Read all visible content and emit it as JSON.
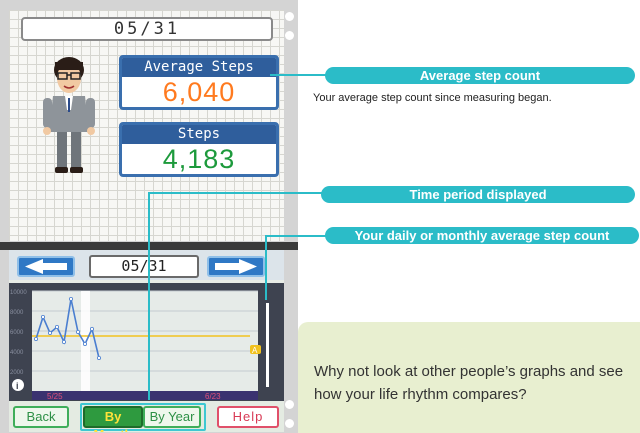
{
  "top_screen": {
    "date": "05/31",
    "average_steps_label": "Average Steps",
    "average_steps_value": "6,040",
    "steps_label": "Steps",
    "steps_value": "4,183"
  },
  "bottom_screen": {
    "date": "05/31",
    "graph": {
      "y_ticks": [
        "10000",
        "8000",
        "6000",
        "4000",
        "2000"
      ],
      "x_start_label": "5/25",
      "x_end_label": "6/23",
      "average_marker": "A",
      "info_badge": "i"
    },
    "buttons": {
      "back": "Back",
      "by_month": "By Month",
      "by_year": "By Year",
      "help": "Help"
    }
  },
  "callouts": {
    "average_step_count_title": "Average step count",
    "average_step_count_desc": "Your average step count since measuring began.",
    "time_period_title": "Time period displayed",
    "daily_monthly_title": "Your daily or monthly average step count"
  },
  "tip_text": "Why not look at other people’s graphs and see how your life rhythm compares?",
  "colors": {
    "callout_teal": "#2bbcc8",
    "average_orange": "#ff7a1f",
    "steps_green": "#1d9a3c",
    "header_blue": "#2f5e9c",
    "tip_background": "#e8efd0"
  },
  "chart_data": {
    "type": "line",
    "x_labels": [
      "5/25",
      "6/23"
    ],
    "series": [
      {
        "values": [
          5200,
          7400,
          5800,
          6400,
          4900,
          9200,
          5900,
          4700,
          6200,
          3300
        ]
      }
    ],
    "average": 5500,
    "ylim": [
      0,
      10000
    ],
    "y_ticks": [
      2000,
      4000,
      6000,
      8000,
      10000
    ]
  }
}
